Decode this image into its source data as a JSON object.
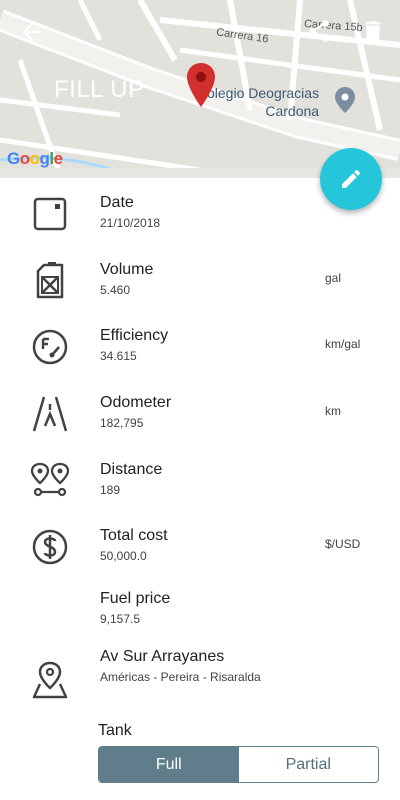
{
  "header": {
    "title": "FILL UP",
    "streets": [
      "Carrera 16",
      "Carrera 15b"
    ],
    "place_line1": "olegio Deogracias",
    "place_line2": "Cardona",
    "map_logo": "Google",
    "icons": [
      "back-arrow-icon",
      "share-icon",
      "delete-icon",
      "map-pin-icon"
    ]
  },
  "fab": {
    "icon": "edit-pencil-icon"
  },
  "rows": [
    {
      "label": "Date",
      "value": "21/10/2018",
      "unit": "",
      "icon": "calendar-icon"
    },
    {
      "label": "Volume",
      "value": "5.460",
      "unit": "gal",
      "icon": "fuel-can-icon"
    },
    {
      "label": "Efficiency",
      "value": "34.615",
      "unit": "km/gal",
      "icon": "fuel-gauge-icon"
    },
    {
      "label": "Odometer",
      "value": "182,795",
      "unit": "km",
      "icon": "road-icon"
    },
    {
      "label": "Distance",
      "value": "189",
      "unit": "",
      "icon": "route-pins-icon"
    },
    {
      "label": "Total cost",
      "value": "50,000.0",
      "unit": "$/USD",
      "icon": "dollar-icon"
    },
    {
      "label": "Fuel price",
      "value": "9,157.5",
      "unit": "",
      "icon": ""
    },
    {
      "label": "Av Sur Arrayanes",
      "value": "Américas - Pereira - Risaralda",
      "unit": "",
      "icon": "location-map-icon"
    }
  ],
  "tank": {
    "label": "Tank",
    "options": [
      "Full",
      "Partial"
    ],
    "selected": "Full"
  },
  "colors": {
    "fab": "#26c6da",
    "toggle_active": "#607d8b",
    "pin": "#d32f2f"
  }
}
